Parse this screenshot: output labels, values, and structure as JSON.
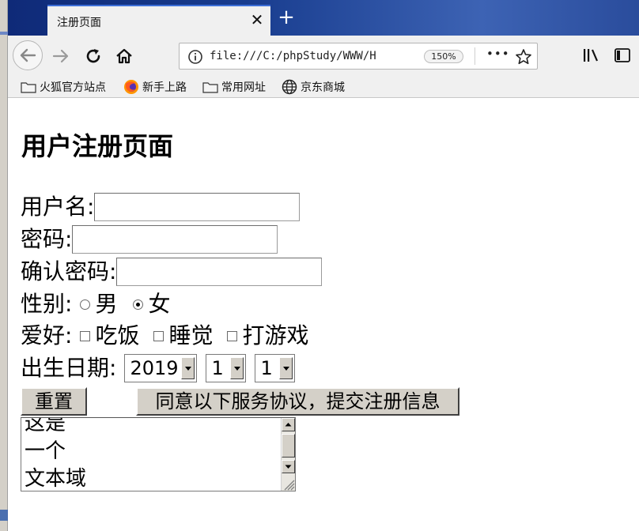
{
  "browser": {
    "tab_title": "注册页面",
    "tab_close_glyph": "✕",
    "new_tab_glyph": "+",
    "url": "file:///C:/phpStudy/WWW/H",
    "zoom": "150%",
    "menu_glyph": "•••",
    "bookmarks": [
      {
        "label": "火狐官方站点",
        "icon": "folder-icon"
      },
      {
        "label": "新手上路",
        "icon": "firefox-icon"
      },
      {
        "label": "常用网址",
        "icon": "folder-icon"
      },
      {
        "label": "京东商城",
        "icon": "globe-icon"
      }
    ]
  },
  "page": {
    "title": "用户注册页面",
    "username_label": "用户名:",
    "password_label": "密码:",
    "confirm_label": "确认密码:",
    "gender_label": "性别:",
    "gender_options": [
      "男",
      "女"
    ],
    "gender_selected": "女",
    "hobby_label": "爱好:",
    "hobby_options": [
      "吃饭",
      "睡觉",
      "打游戏"
    ],
    "birth_label": "出生日期:",
    "birth_year": "2019",
    "birth_month": "1",
    "birth_day": "1",
    "reset_button": "重置",
    "submit_button": "同意以下服务协议，提交注册信息",
    "textarea_lines": [
      "这是",
      "一个",
      "文本域"
    ]
  },
  "colors": {
    "tabbar_start": "#0f2a78",
    "tabbar_end": "#3d63b4",
    "button_face": "#d4d0c8"
  }
}
